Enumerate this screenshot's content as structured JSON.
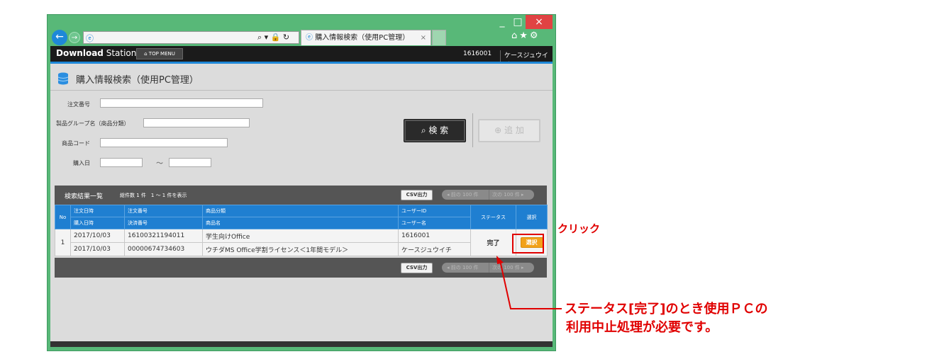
{
  "browser": {
    "tab_title": "購入情報検索（使用PC管理）",
    "tab_close": "×",
    "window_min": "_",
    "window_max": "□",
    "window_close": "×",
    "addr_icons": "⌕ ▾ 🔒 ↻"
  },
  "app": {
    "brand_bold": "Download",
    "brand_rest": " Station",
    "top_menu": "TOP MENU",
    "user_id": "1616001",
    "user_name": "ケースジュウイチ"
  },
  "page": {
    "title": "購入情報検索（使用PC管理）"
  },
  "form": {
    "order_no_label": "注文番号",
    "product_group_label": "製品グループ名（商品分類）",
    "product_code_label": "商品コード",
    "purchase_date_label": "購入日",
    "date_separator": "～",
    "search_button": "検 索",
    "add_button": "追 加"
  },
  "results": {
    "title": "検索結果一覧",
    "count": "総件数 1 件　1 ～ 1 件を表示",
    "csv_button": "CSV出力",
    "pager_prev": "◂ 前の 100 件",
    "pager_next": "次の 100 件 ▸",
    "headers": {
      "no": "No",
      "order_date": "注文日時",
      "order_no": "注文番号",
      "category": "商品分類",
      "user_id": "ユーザーID",
      "status": "ステータス",
      "select": "選択",
      "purchase_date": "購入日時",
      "payment_no": "決済番号",
      "product_name": "商品名",
      "user_name": "ユーザー名"
    },
    "rows": [
      {
        "no": "1",
        "order_date": "2017/10/03",
        "order_no": "16100321194011",
        "category": "学生向けOffice",
        "user_id": "1616001",
        "purchase_date": "2017/10/03",
        "payment_no": "00000674734603",
        "product_name": "ウチダMS Office学割ライセンス＜1年間モデル＞",
        "user_name": "ケースジュウイチ",
        "status": "完了",
        "select": "選択"
      }
    ]
  },
  "annotations": {
    "click": "クリック",
    "note_line1": "ステータス[完了]のとき使用ＰＣの",
    "note_line2": "利用中止処理が必要です。",
    "color": "#e00000"
  },
  "colors": {
    "window_frame": "#58b878",
    "header_blue": "#1f7fd1",
    "select_orange": "#f2a11a"
  }
}
